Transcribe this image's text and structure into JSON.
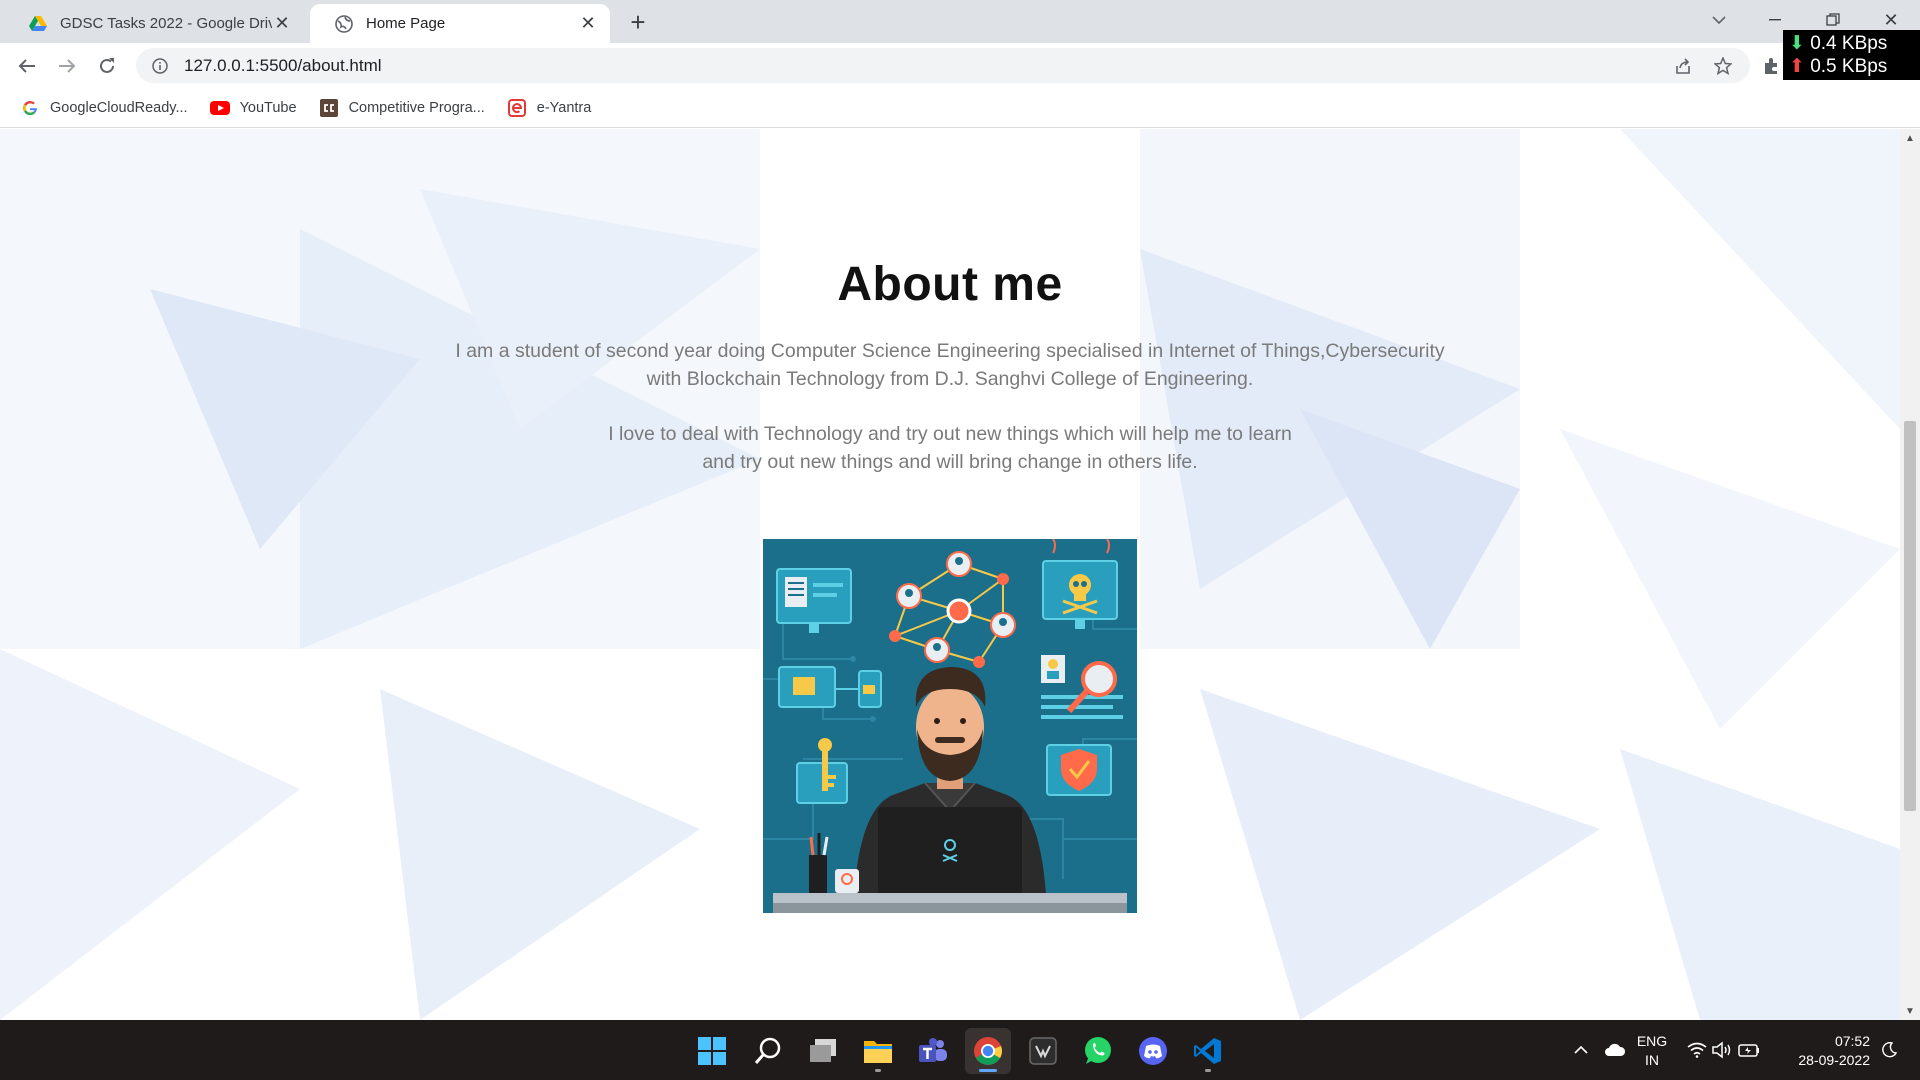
{
  "browser": {
    "tabs": [
      {
        "title": "GDSC Tasks 2022 - Google Drive",
        "icon": "google-drive-icon",
        "active": false
      },
      {
        "title": "Home Page",
        "icon": "globe-icon",
        "active": true
      }
    ],
    "address": "127.0.0.1:5500/about.html",
    "bookmarks": [
      {
        "label": "GoogleCloudReady...",
        "icon": "google-icon"
      },
      {
        "label": "YouTube",
        "icon": "youtube-icon"
      },
      {
        "label": "Competitive Progra...",
        "icon": "codechef-icon"
      },
      {
        "label": "e-Yantra",
        "icon": "eyantra-icon"
      }
    ],
    "netspeed": {
      "down": "0.4 KBps",
      "up": "0.5 KBps"
    }
  },
  "page": {
    "heading": "About me",
    "paragraph1": [
      "I am a student of second year doing Computer Science Engineering specialised in Internet of Things,Cybersecurity",
      "with Blockchain Technology from D.J. Sanghvi College of Engineering."
    ],
    "paragraph2": [
      "I love to deal with Technology and try out new things which will help me to learn",
      "and try out new things and will bring change in others life."
    ],
    "illustration": "hacker-illustration"
  },
  "taskbar": {
    "apps": [
      "windows-start-icon",
      "search-icon",
      "task-view-icon",
      "file-explorer-icon",
      "teams-icon",
      "chrome-icon",
      "terminal-icon",
      "whatsapp-icon",
      "discord-icon",
      "vscode-icon"
    ],
    "language": {
      "line1": "ENG",
      "line2": "IN"
    },
    "time": "07:52",
    "date": "28-09-2022"
  },
  "colors": {
    "accent": "#1a73e8",
    "illustration_bg": "#1b6f8a",
    "taskbar_bg": "#1f1b1a"
  }
}
